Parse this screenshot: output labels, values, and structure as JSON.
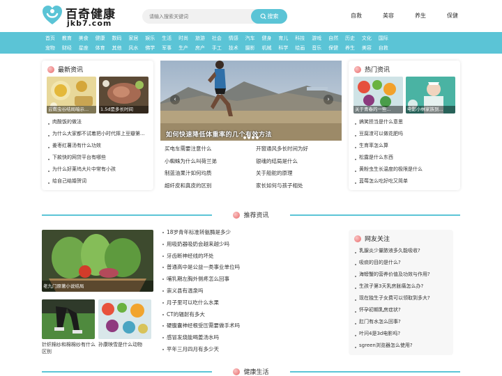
{
  "header": {
    "logo_cn": "百奇健康",
    "logo_en": "jkb7.com",
    "search_placeholder": "请输入搜索关键词",
    "search_button": "搜索",
    "top_links": [
      "自救",
      "美容",
      "养生",
      "保健"
    ]
  },
  "nav": {
    "row1": [
      "首页",
      "教育",
      "美食",
      "健康",
      "数码",
      "家居",
      "娱乐",
      "生活",
      "时尚",
      "旅游",
      "社会",
      "情感",
      "汽车",
      "健身",
      "育儿",
      "科技",
      "游戏",
      "自然",
      "历史",
      "文化",
      "国际"
    ],
    "row2": [
      "宠物",
      "财经",
      "星座",
      "体育",
      "其他",
      "风水",
      "佛学",
      "军事",
      "生产",
      "房产",
      "手工",
      "技术",
      "摄影",
      "机械",
      "科学",
      "绘画",
      "音乐",
      "保健",
      "养生",
      "美容",
      "自救"
    ]
  },
  "latest": {
    "title": "最新资讯",
    "thumbs": [
      "云南虫谷结局暗示...",
      "1.5d是多长时间"
    ],
    "items": [
      "肉酸饭的做法",
      "为什么大家都不试着把小时代摔上豆瓣第...",
      "姜枣红薯汤有什么功效",
      "下款快的网贷平台有哪些",
      "为什么好莱坞大片中常有小孩",
      "给自己结婚贺词"
    ]
  },
  "slider": {
    "caption": "如何快速降低体重率的几个有效方法",
    "prev": "‹",
    "next": "›",
    "dots": "● ● ● ●"
  },
  "center_links": [
    "买电车需要注意什么",
    "开窗通风多长时间为好",
    "小蜘蛛为什么叫荷兰弟",
    "银魂的结局是什么",
    "制蓝油果汁如何均质",
    "关于船舵的原理",
    "超纤皮和真皮的区别",
    "家长如何与孩子相处"
  ],
  "hot": {
    "title": "热门资讯",
    "thumbs": [
      "关于青春的一些...",
      "电影小林家族到..."
    ],
    "items": [
      "搞笑担当是什么意思",
      "豆腐渣可以做花肥吗",
      "生育率怎么算",
      "松露是什么东西",
      "黄粉虫生长温度的极限是什么",
      "蓝莓怎么吃好吃又简单"
    ]
  },
  "recommend": {
    "title": "推荐资讯",
    "big_caption": "老九门原著小说结局",
    "small_captions": [
      "针织棉纱和棉棉纱有什么区别",
      "孙康映雪是什么动物"
    ],
    "items": [
      "18岁青年标准转氨酶是多少",
      "用吸奶器吸奶会越来越少吗",
      "牙齿断神经线的坏处",
      "普通高中是公益一类事业单位吗",
      "哺乳期左胸外侧疼怎么回事",
      "崇义县有温泉吗",
      "月子里可以吃什么水果",
      "CT的辐射有多大",
      "硬腹囊神经根受压需要做手术吗",
      "感冒发烧能喝姜汤水吗",
      "平年三月四月有多少天"
    ]
  },
  "friends": {
    "title": "网友关注",
    "items": [
      "乳腺炎少量脓液多久能吸收?",
      "吸痰的目的是什么?",
      "海螃蟹的营养价值及功效与作用?",
      "生孩子第3天乳房胀痛怎么办?",
      "现在独生子女费可以领取到多大?",
      "怀孕初期乳房症状?",
      "肛门有水怎么回事?",
      "叶问4是3d电影吗?",
      "sgreen浏览器怎么使用?"
    ]
  },
  "health": {
    "title": "健康生活"
  },
  "colors": {
    "accent": "#5bc4d6",
    "dot": "#f08c8c"
  }
}
